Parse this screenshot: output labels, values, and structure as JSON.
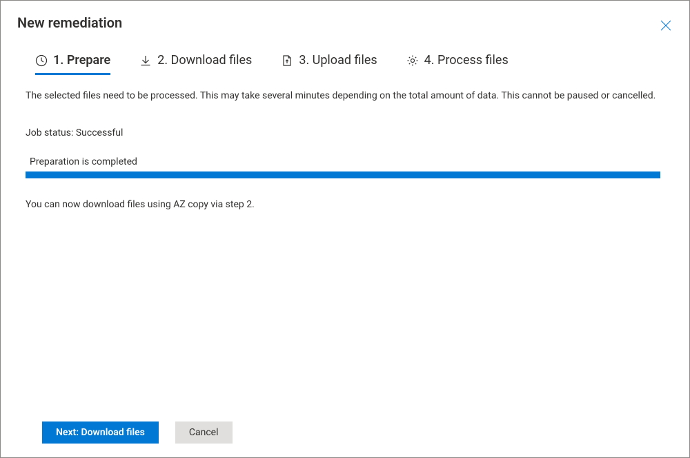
{
  "header": {
    "title": "New remediation"
  },
  "tabs": {
    "prepare": "1. Prepare",
    "download": "2. Download files",
    "upload": "3. Upload files",
    "process": "4. Process files"
  },
  "content": {
    "intro": "The selected files need to be processed. This may take several minutes depending on the total amount of data. This cannot be paused or cancelled.",
    "status_label": "Job status: ",
    "status_value": "Successful",
    "progress_label": "Preparation is completed",
    "post_message": "You can now download files using AZ copy via step 2."
  },
  "footer": {
    "next_label": "Next: Download files",
    "cancel_label": "Cancel"
  }
}
